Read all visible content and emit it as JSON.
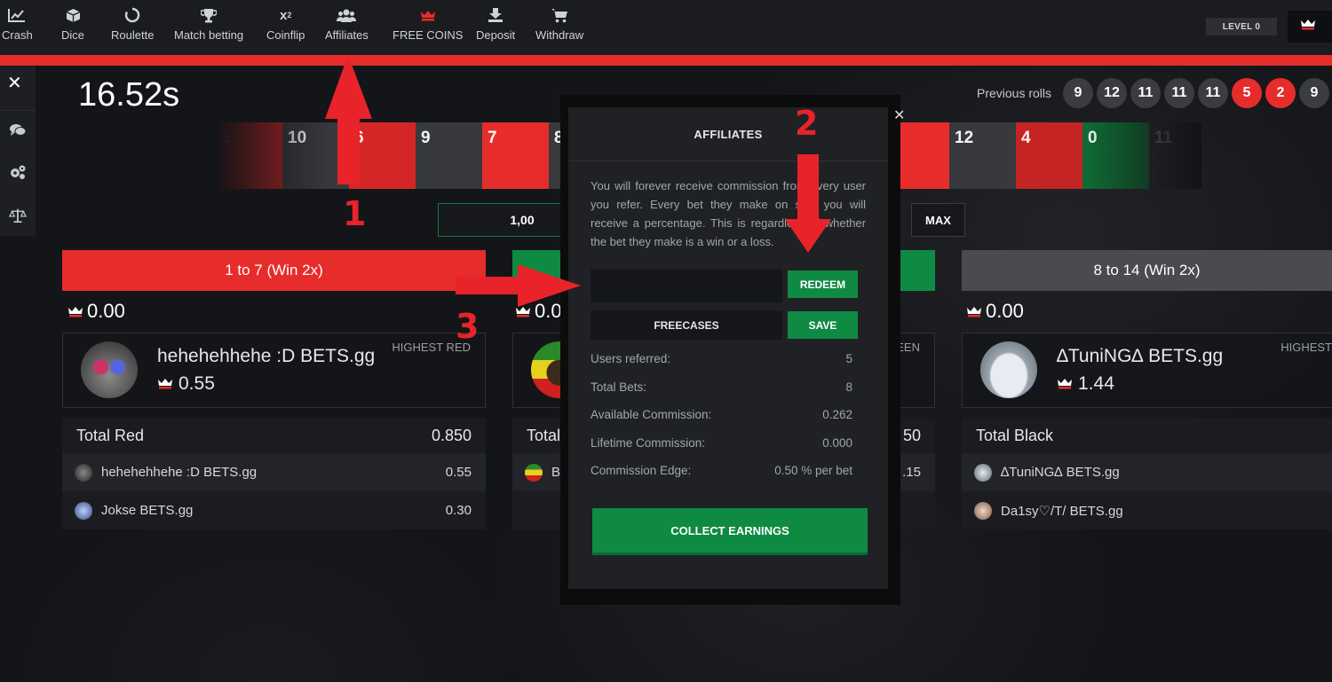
{
  "nav": {
    "items": [
      {
        "label": "Crash",
        "icon": "chart-line-icon"
      },
      {
        "label": "Dice",
        "icon": "cube-icon"
      },
      {
        "label": "Roulette",
        "icon": "circle-icon"
      },
      {
        "label": "Match betting",
        "icon": "trophy-icon"
      },
      {
        "label": "Coinflip",
        "icon": "x-squared-icon"
      },
      {
        "label": "Affiliates",
        "icon": "users-icon"
      },
      {
        "label": "FREE COINS",
        "icon": "crown-icon"
      },
      {
        "label": "Deposit",
        "icon": "download-icon"
      },
      {
        "label": "Withdraw",
        "icon": "cart-icon"
      }
    ],
    "level": "LEVEL 0"
  },
  "timer": "16.52s",
  "previous_rolls": {
    "label": "Previous rolls",
    "rolls": [
      "9",
      "12",
      "11",
      "11",
      "11",
      "5",
      "2",
      "9"
    ]
  },
  "reel": {
    "tiles": [
      "5",
      "10",
      "6",
      "9",
      "7",
      "8",
      "12",
      "4",
      "0",
      "11"
    ]
  },
  "bet": {
    "amount": "1,00",
    "max_label": "MAX"
  },
  "columns": {
    "red": {
      "button": "1 to 7 (Win 2x)",
      "amount": "0.00",
      "highest_tag": "HIGHEST RED",
      "highest_name": "hehehehhehe :D BETS.gg",
      "highest_amount": "0.55",
      "total_label": "Total Red",
      "total_value": "0.850",
      "rows": [
        {
          "name": "hehehehhehe :D BETS.gg",
          "amount": "0.55"
        },
        {
          "name": "Jokse BETS.gg",
          "amount": "0.30"
        }
      ]
    },
    "green": {
      "amount": "0.0",
      "highest_tag": "EEN",
      "total_label": "Total",
      "total_value": "50",
      "row_initial": "B",
      "row_amount": ".15"
    },
    "black": {
      "button": "8 to 14 (Win 2x)",
      "amount": "0.00",
      "highest_tag": "HIGHEST",
      "highest_name": "∆TuniNG∆ BETS.gg",
      "highest_amount": "1.44",
      "total_label": "Total Black",
      "rows": [
        {
          "name": "∆TuniNG∆ BETS.gg"
        },
        {
          "name": "Da1sy♡/T/ BETS.gg"
        }
      ]
    }
  },
  "modal": {
    "title": "AFFILIATES",
    "description": "You will forever receive commission from every user you refer. Every bet they make on site, you will receive a percentage. This is regardless of whether the bet they make is a win or a loss.",
    "code_placeholder": "",
    "redeem_label": "REDEEM",
    "freecases_label": "FREECASES",
    "save_label": "SAVE",
    "stats": [
      {
        "label": "Users referred:",
        "value": "5"
      },
      {
        "label": "Total Bets:",
        "value": "8"
      },
      {
        "label": "Available Commission:",
        "value": "0.262"
      },
      {
        "label": "Lifetime Commission:",
        "value": "0.000"
      },
      {
        "label": "Commission Edge:",
        "value": "0.50 % per bet"
      }
    ],
    "collect_label": "COLLECT EARNINGS"
  },
  "annotations": [
    "1",
    "2",
    "3"
  ],
  "colors": {
    "red": "#e72c2c",
    "green": "#0f8a43",
    "grey": "#4a4b4f",
    "accent_arrow": "#e8232a"
  }
}
